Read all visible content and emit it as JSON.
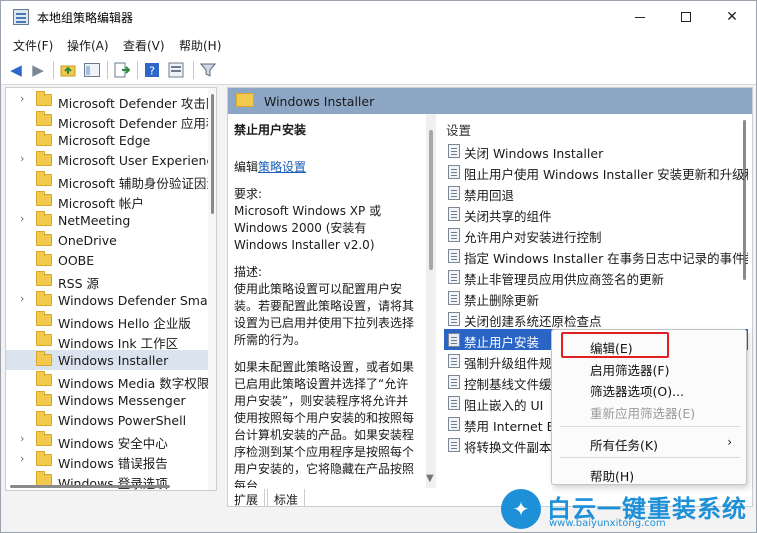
{
  "window": {
    "title": "本地组策略编辑器"
  },
  "menu": [
    "文件(F)",
    "操作(A)",
    "查看(V)",
    "帮助(H)"
  ],
  "tree": {
    "items": [
      {
        "label": "Microsoft Defender 攻击防",
        "expandable": true
      },
      {
        "label": "Microsoft Defender 应用程",
        "expandable": false
      },
      {
        "label": "Microsoft Edge",
        "expandable": false
      },
      {
        "label": "Microsoft User Experience",
        "expandable": true
      },
      {
        "label": "Microsoft 辅助身份验证因素",
        "expandable": false
      },
      {
        "label": "Microsoft 帐户",
        "expandable": false
      },
      {
        "label": "NetMeeting",
        "expandable": true
      },
      {
        "label": "OneDrive",
        "expandable": false
      },
      {
        "label": "OOBE",
        "expandable": false
      },
      {
        "label": "RSS 源",
        "expandable": false
      },
      {
        "label": "Windows Defender Smart",
        "expandable": true
      },
      {
        "label": "Windows Hello 企业版",
        "expandable": false
      },
      {
        "label": "Windows Ink 工作区",
        "expandable": false
      },
      {
        "label": "Windows Installer",
        "expandable": false,
        "selected": true
      },
      {
        "label": "Windows Media 数字权限",
        "expandable": false
      },
      {
        "label": "Windows Messenger",
        "expandable": false
      },
      {
        "label": "Windows PowerShell",
        "expandable": false
      },
      {
        "label": "Windows 安全中心",
        "expandable": true
      },
      {
        "label": "Windows 错误报告",
        "expandable": true
      },
      {
        "label": "Windows 登录选项",
        "expandable": false
      }
    ]
  },
  "header": {
    "title": "Windows Installer"
  },
  "description": {
    "title": "禁止用户安装",
    "edit_prefix": "编辑",
    "edit_link": "策略设置",
    "req_label": "要求:",
    "req_text": "Microsoft Windows XP 或 Windows 2000 (安装有 Windows Installer v2.0)",
    "desc_label": "描述:",
    "desc_text": "使用此策略设置可以配置用户安装。若要配置此策略设置，请将其设置为已启用并使用下拉列表选择所需的行为。",
    "desc_text2": "如果未配置此策略设置，或者如果已启用此策略设置并选择了“允许用户安装”，则安装程序将允许并使用按照每个用户安装的和按照每台计算机安装的产品。如果安装程序检测到某个应用程序是按照每个用户安装的，它将隐藏在产品按照每台"
  },
  "list": {
    "column": "设置",
    "items": [
      {
        "label": "关闭 Windows Installer"
      },
      {
        "label": "阻止用户使用 Windows Installer 安装更新和升级程"
      },
      {
        "label": "禁用回退"
      },
      {
        "label": "关闭共享的组件"
      },
      {
        "label": "允许用户对安装进行控制"
      },
      {
        "label": "指定 Windows Installer 在事务日志中记录的事件类"
      },
      {
        "label": "禁止非管理员应用供应商签名的更新"
      },
      {
        "label": "禁止删除更新"
      },
      {
        "label": "关闭创建系统还原检查点"
      },
      {
        "label": "禁止用户安装",
        "selected": true
      },
      {
        "label": "强制升级组件规则"
      },
      {
        "label": "控制基线文件缓存"
      },
      {
        "label": "阻止嵌入的 UI"
      },
      {
        "label": "禁用 Internet Ex"
      },
      {
        "label": "将转换文件副本保"
      }
    ]
  },
  "tabs": [
    "扩展",
    "标准"
  ],
  "context_menu": {
    "items": [
      {
        "label": "编辑(E)",
        "highlighted": true
      },
      {
        "label": "启用筛选器(F)"
      },
      {
        "label": "筛选器选项(O)..."
      },
      {
        "label": "重新应用筛选器(E)",
        "disabled": true
      },
      {
        "label": "所有任务(K)",
        "submenu": true
      },
      {
        "label": "帮助(H)"
      }
    ]
  },
  "watermark": {
    "brand": "白云一键重装系统",
    "url": "www.baiyunxitong.com"
  },
  "colors": {
    "selection": "#2a64c5",
    "header": "#8ea6c6",
    "highlight_border": "#e02020",
    "brand": "#1e90d8"
  }
}
